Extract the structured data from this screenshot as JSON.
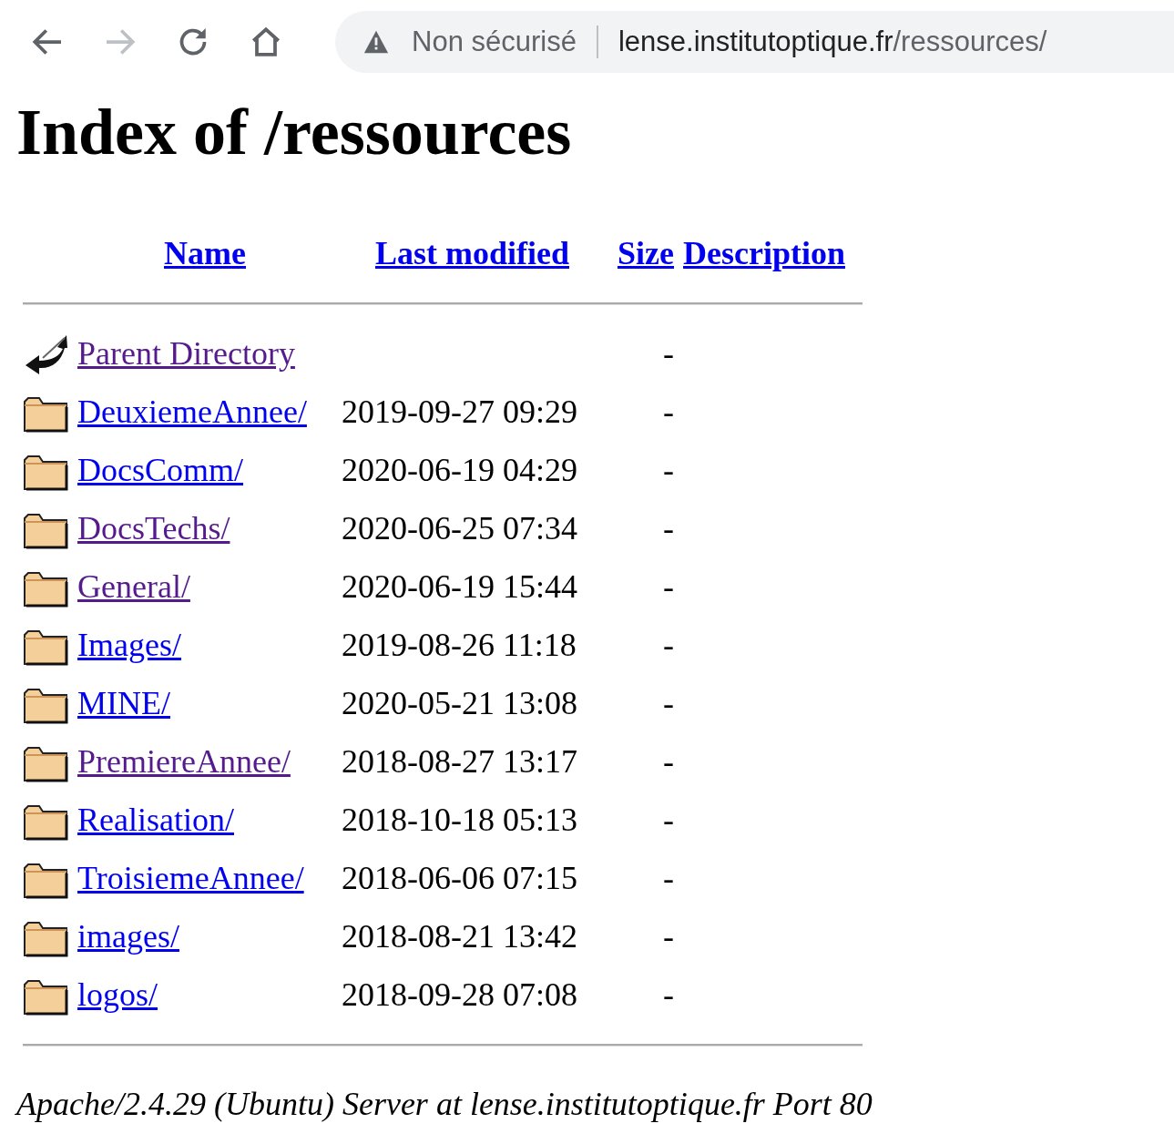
{
  "browser": {
    "security_label": "Non sécurisé",
    "url_host": "lense.institutoptique.fr",
    "url_path": "/ressources/"
  },
  "heading": "Index of /ressources",
  "table": {
    "columns": [
      "Name",
      "Last modified",
      "Size",
      "Description"
    ],
    "rows": [
      {
        "kind": "parent",
        "name": "Parent Directory",
        "size": "-",
        "visited": true
      },
      {
        "kind": "folder",
        "name": "DeuxiemeAnnee/",
        "modified": "2019-09-27 09:29",
        "size": "-",
        "visited": false
      },
      {
        "kind": "folder",
        "name": "DocsComm/",
        "modified": "2020-06-19 04:29",
        "size": "-",
        "visited": false
      },
      {
        "kind": "folder",
        "name": "DocsTechs/",
        "modified": "2020-06-25 07:34",
        "size": "-",
        "visited": true
      },
      {
        "kind": "folder",
        "name": "General/",
        "modified": "2020-06-19 15:44",
        "size": "-",
        "visited": true
      },
      {
        "kind": "folder",
        "name": "Images/",
        "modified": "2019-08-26 11:18",
        "size": "-",
        "visited": false
      },
      {
        "kind": "folder",
        "name": "MINE/",
        "modified": "2020-05-21 13:08",
        "size": "-",
        "visited": false
      },
      {
        "kind": "folder",
        "name": "PremiereAnnee/",
        "modified": "2018-08-27 13:17",
        "size": "-",
        "visited": true
      },
      {
        "kind": "folder",
        "name": "Realisation/",
        "modified": "2018-10-18 05:13",
        "size": "-",
        "visited": false
      },
      {
        "kind": "folder",
        "name": "TroisiemeAnnee/",
        "modified": "2018-06-06 07:15",
        "size": "-",
        "visited": false
      },
      {
        "kind": "folder",
        "name": "images/",
        "modified": "2018-08-21 13:42",
        "size": "-",
        "visited": false
      },
      {
        "kind": "folder",
        "name": "logos/",
        "modified": "2018-09-28 07:08",
        "size": "-",
        "visited": false
      }
    ]
  },
  "footer": "Apache/2.4.29 (Ubuntu) Server at lense.institutoptique.fr Port 80"
}
